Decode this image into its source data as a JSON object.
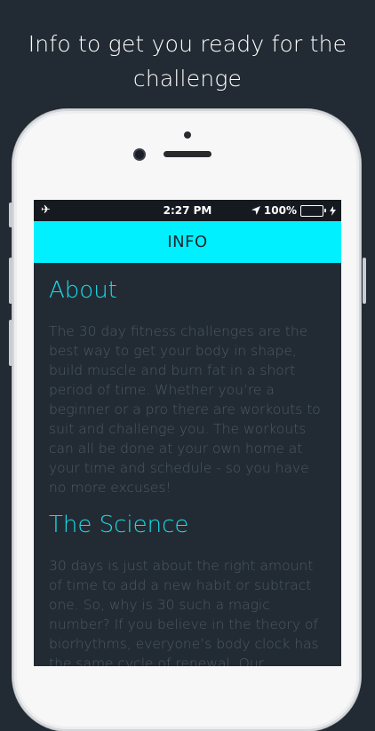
{
  "headline": {
    "line1": "Info to get you ready for the",
    "line2": "challenge"
  },
  "status_bar": {
    "time": "2:27 PM",
    "battery": "100%",
    "airplane_icon": "airplane-icon",
    "location_icon": "location-arrow-icon",
    "charging_icon": "bolt-icon"
  },
  "nav": {
    "title": "INFO"
  },
  "sections": [
    {
      "title": "About",
      "body": "The 30 day fitness challenges are the best way to get your body in shape, build muscle and burn fat in a short period of time. Whether you’re a beginner or a pro there are workouts to suit and challenge you. The workouts can all be done at your own home at your time and schedule - so you have no more excuses!"
    },
    {
      "title": "The Science",
      "body": "30 days is just about the right amount of time to add a new habit or subtract one. So, why is 30 such a magic number? If you believe in the theory of biorhythms, everyone’s body clock has the same cycle of renewal. Our"
    }
  ],
  "colors": {
    "background": "#222b33",
    "accent": "#00f0ff",
    "title": "#19dcea",
    "body_text": "#4b5866"
  }
}
